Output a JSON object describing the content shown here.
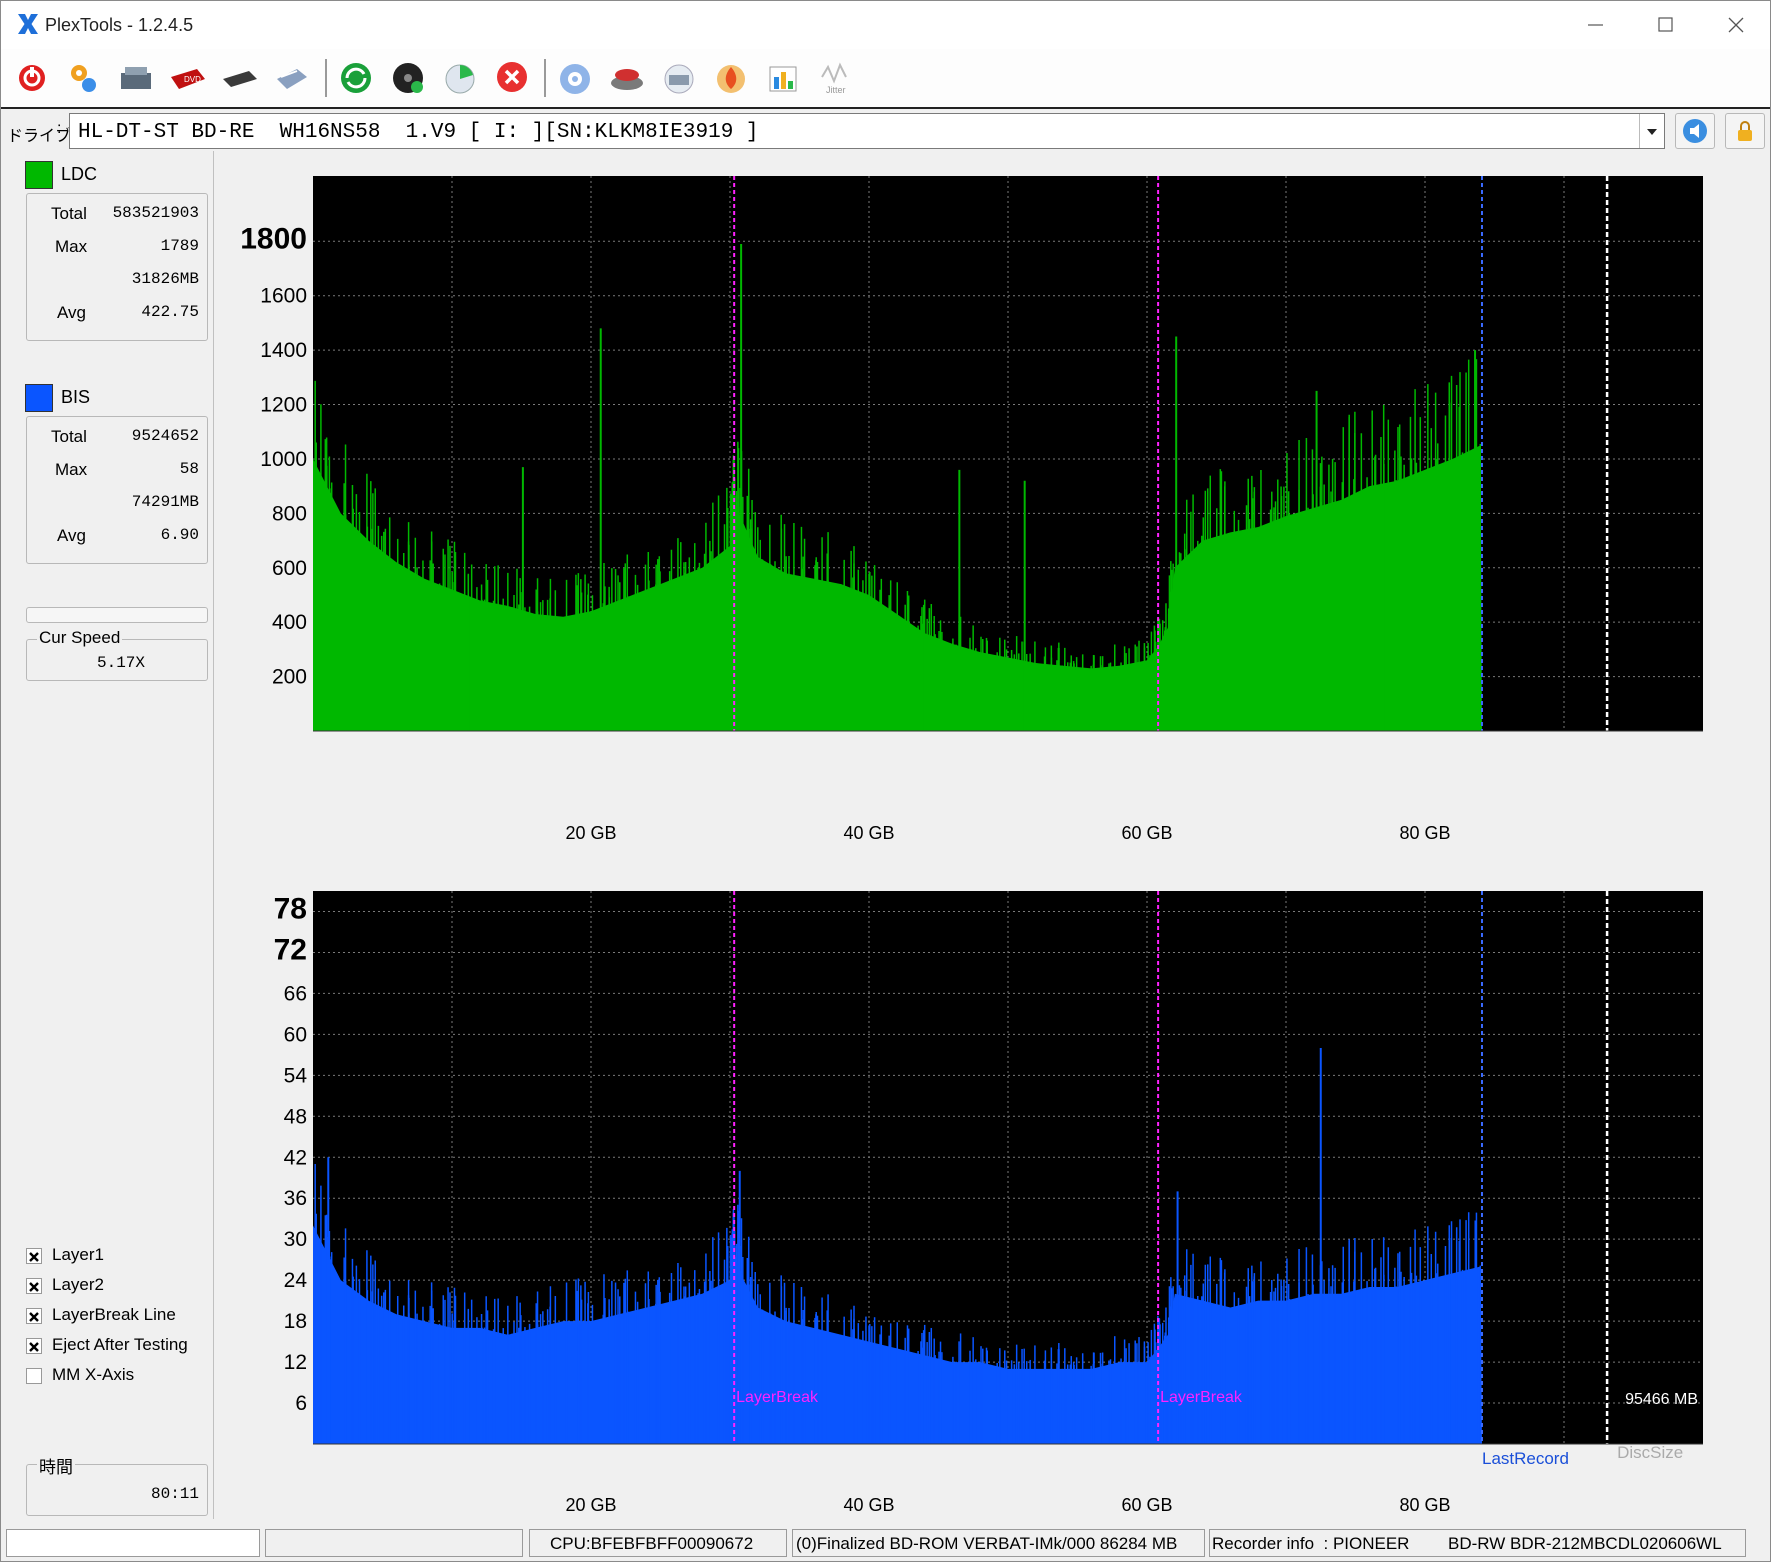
{
  "window": {
    "title": "PlexTools - 1.2.4.5"
  },
  "toolbar": {
    "icons": [
      "power-icon",
      "settings-wrench-icon",
      "drive-info-icon",
      "dvd-info-icon",
      "disc-info-icon",
      "scanner-icon",
      "refresh-icon",
      "disc-test-icon",
      "disc-chart-icon",
      "stop-icon",
      "disc-icon",
      "burner-icon",
      "print-icon",
      "burn-icon",
      "report-icon",
      "jitter-icon"
    ],
    "jitter_label": "Jitter"
  },
  "drive": {
    "label": "ドライブ",
    "value": "HL-DT-ST BD-RE  WH16NS58  1.V9 [ I: ][SN:KLKM8IE3919 ]"
  },
  "ldc": {
    "label": "LDC",
    "color": "#00b800",
    "total_label": "Total",
    "total": "583521903",
    "max_label": "Max",
    "max": "1789",
    "max_pos": "31826MB",
    "avg_label": "Avg",
    "avg": "422.75"
  },
  "bis": {
    "label": "BIS",
    "color": "#0a55ff",
    "total_label": "Total",
    "total": "9524652",
    "max_label": "Max",
    "max": "58",
    "max_pos": "74291MB",
    "avg_label": "Avg",
    "avg": "6.90"
  },
  "speed": {
    "label": "Cur Speed",
    "value": "5.17X"
  },
  "options": [
    {
      "label": "Layer1",
      "checked": true
    },
    {
      "label": "Layer2",
      "checked": true
    },
    {
      "label": "LayerBreak Line",
      "checked": true
    },
    {
      "label": "Eject After Testing",
      "checked": true
    },
    {
      "label": "MM X-Axis",
      "checked": false
    }
  ],
  "time": {
    "label": "時間",
    "value": "80:11"
  },
  "status": {
    "cpu": "CPU:BFEBFBFF00090672",
    "disc": "(0)Finalized   BD-ROM   VERBAT-IMk/000   86284 MB",
    "recorder": "Recorder info  : PIONEER",
    "recorder_model": "BD-RW    BDR-212MBCDL020606WL"
  },
  "chart_data": [
    {
      "type": "area",
      "name": "LDC",
      "color": "#00b800",
      "xlim": [
        0,
        100
      ],
      "x_ticks": [
        "20 GB",
        "40 GB",
        "60 GB",
        "80 GB"
      ],
      "x_tick_values": [
        20,
        40,
        60,
        80
      ],
      "ylim": [
        0,
        2040
      ],
      "y_ticks": [
        200,
        400,
        600,
        800,
        1000,
        1200,
        1400,
        1600,
        1800
      ],
      "layer_breaks": [
        30.3,
        60.8
      ],
      "last_record": 84.1,
      "disc_size": 93.1,
      "x": [
        0,
        2,
        4,
        6,
        8,
        10,
        12,
        14,
        16,
        18,
        20,
        22,
        24,
        26,
        28,
        30,
        30.3,
        31,
        32,
        34,
        36,
        38,
        40,
        42,
        44,
        46,
        48,
        50,
        52,
        54,
        56,
        58,
        60,
        60.8,
        61.5,
        62,
        64,
        66,
        68,
        70,
        72,
        74,
        76,
        78,
        80,
        82,
        84,
        84.1
      ],
      "y": [
        1000,
        800,
        700,
        620,
        560,
        520,
        480,
        460,
        430,
        420,
        440,
        480,
        520,
        560,
        600,
        680,
        830,
        760,
        640,
        580,
        560,
        540,
        500,
        430,
        360,
        320,
        290,
        270,
        250,
        240,
        230,
        240,
        260,
        310,
        380,
        600,
        700,
        730,
        750,
        790,
        820,
        850,
        900,
        920,
        960,
        1000,
        1050,
        0
      ],
      "spikes": [
        {
          "x": 20.7,
          "y": 1480
        },
        {
          "x": 30.8,
          "y": 1790
        },
        {
          "x": 62.1,
          "y": 1450
        },
        {
          "x": 83.6,
          "y": 1400
        },
        {
          "x": 72.2,
          "y": 1250
        },
        {
          "x": 15.1,
          "y": 970
        },
        {
          "x": 46.5,
          "y": 960
        },
        {
          "x": 51.2,
          "y": 920
        }
      ]
    },
    {
      "type": "area",
      "name": "BIS",
      "color": "#0a55ff",
      "xlim": [
        0,
        100
      ],
      "x_ticks": [
        "20 GB",
        "40 GB",
        "60 GB",
        "80 GB"
      ],
      "x_tick_values": [
        20,
        40,
        60,
        80
      ],
      "ylim": [
        0,
        81
      ],
      "y_ticks": [
        6,
        12,
        18,
        24,
        30,
        36,
        42,
        48,
        54,
        60,
        66,
        72,
        78
      ],
      "layer_breaks": [
        30.3,
        60.8
      ],
      "layer_break_label": "LayerBreak",
      "last_record": 84.1,
      "last_record_label": "LastRecord",
      "disc_size": 93.1,
      "disc_size_label": "DiscSize",
      "disc_size_value": "95466 MB",
      "x": [
        0,
        2,
        4,
        6,
        8,
        10,
        12,
        14,
        16,
        18,
        20,
        22,
        24,
        26,
        28,
        30,
        30.3,
        31,
        32,
        34,
        36,
        38,
        40,
        42,
        44,
        46,
        48,
        50,
        52,
        54,
        56,
        58,
        60,
        60.8,
        61.5,
        62,
        64,
        66,
        68,
        70,
        72,
        74,
        76,
        78,
        80,
        82,
        84,
        84.1
      ],
      "y": [
        32,
        24,
        21,
        19,
        18,
        17,
        17,
        16,
        17,
        18,
        18,
        19,
        20,
        21,
        22,
        24,
        28,
        24,
        20,
        18,
        17,
        16,
        15,
        14,
        13,
        12,
        12,
        11,
        11,
        11,
        11,
        12,
        12,
        14,
        16,
        22,
        21,
        20,
        21,
        21,
        22,
        22,
        23,
        23,
        24,
        25,
        26,
        0
      ],
      "spikes": [
        {
          "x": 72.5,
          "y": 58
        },
        {
          "x": 30.7,
          "y": 40
        },
        {
          "x": 1.1,
          "y": 42
        },
        {
          "x": 62.2,
          "y": 37
        }
      ]
    }
  ]
}
